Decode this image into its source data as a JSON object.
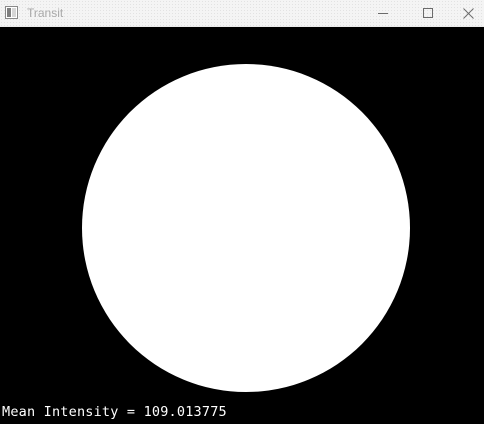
{
  "window": {
    "title": "Transit",
    "icons": {
      "app": "app-window-icon",
      "minimize": "minimize-icon",
      "maximize": "maximize-icon",
      "close": "close-icon"
    }
  },
  "image": {
    "background_color": "#000000",
    "shape": "circle",
    "shape_color": "#ffffff"
  },
  "overlay": {
    "mean_intensity_text": "Mean Intensity = 109.013775"
  }
}
